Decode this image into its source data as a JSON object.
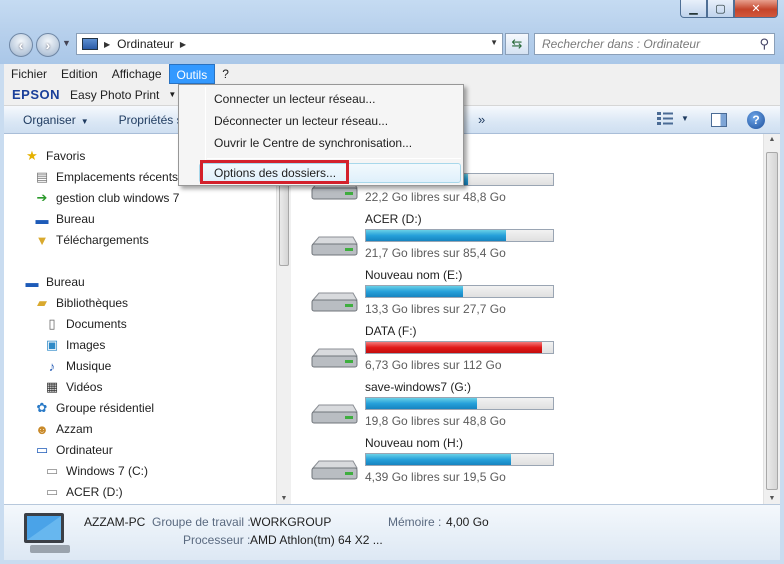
{
  "address": {
    "crumb": "Ordinateur"
  },
  "search": {
    "placeholder": "Rechercher dans : Ordinateur"
  },
  "menubar": [
    "Fichier",
    "Edition",
    "Affichage",
    "Outils",
    "?"
  ],
  "epson": {
    "brand": "EPSON",
    "product": "Easy Photo Print"
  },
  "commandbar": {
    "organize": "Organiser",
    "properties": "Propriétés s",
    "more": "»"
  },
  "dropdown": {
    "items": [
      "Connecter un lecteur réseau...",
      "Déconnecter un lecteur réseau...",
      "Ouvrir le Centre de synchronisation...",
      "Options des dossiers..."
    ]
  },
  "nav": {
    "favorites": "Favoris",
    "recent": "Emplacements récents",
    "club": "gestion club windows 7",
    "desktop_fav": "Bureau",
    "downloads": "Téléchargements",
    "desktop": "Bureau",
    "libraries": "Bibliothèques",
    "documents": "Documents",
    "images": "Images",
    "music": "Musique",
    "videos": "Vidéos",
    "homegroup": "Groupe résidentiel",
    "user": "Azzam",
    "computer": "Ordinateur",
    "drive_c": "Windows 7 (C:)",
    "drive_d": "ACER (D:)"
  },
  "drives": [
    {
      "name": "",
      "free": "22,2 Go libres sur 48,8 Go",
      "used_fraction": 0.545,
      "critical": false,
      "system": true
    },
    {
      "name": "ACER (D:)",
      "free": "21,7 Go libres sur 85,4 Go",
      "used_fraction": 0.746,
      "critical": false,
      "system": false
    },
    {
      "name": "Nouveau nom (E:)",
      "free": "13,3 Go libres sur 27,7 Go",
      "used_fraction": 0.52,
      "critical": false,
      "system": false
    },
    {
      "name": "DATA (F:)",
      "free": "6,73 Go libres sur 112 Go",
      "used_fraction": 0.94,
      "critical": true,
      "system": false
    },
    {
      "name": "save-windows7 (G:)",
      "free": "19,8 Go libres sur 48,8 Go",
      "used_fraction": 0.594,
      "critical": false,
      "system": false
    },
    {
      "name": "Nouveau nom (H:)",
      "free": "4,39 Go libres sur 19,5 Go",
      "used_fraction": 0.775,
      "critical": false,
      "system": false
    }
  ],
  "details": {
    "pc_name": "AZZAM-PC",
    "workgroup_label": "Groupe de travail :",
    "workgroup": "WORKGROUP",
    "memory_label": "Mémoire :",
    "memory": "4,00 Go",
    "cpu_label": "Processeur :",
    "cpu": "AMD Athlon(tm) 64 X2 ..."
  }
}
